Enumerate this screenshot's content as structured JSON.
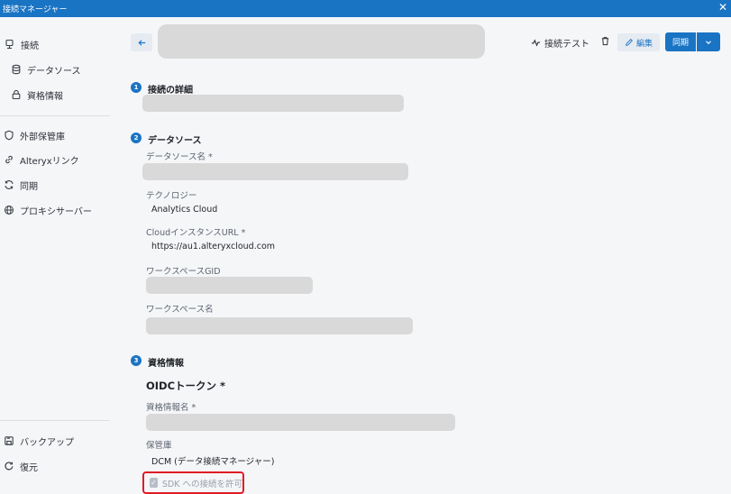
{
  "window": {
    "title": "接続マネージャー",
    "close_glyph": "✕"
  },
  "sidebar": {
    "items": [
      {
        "label": "接続",
        "icon": "connection-icon"
      },
      {
        "label": "データソース",
        "icon": "database-icon"
      },
      {
        "label": "資格情報",
        "icon": "lock-icon"
      },
      {
        "label": "外部保管庫",
        "icon": "shield-icon"
      },
      {
        "label": "Alteryxリンク",
        "icon": "link-icon"
      },
      {
        "label": "同期",
        "icon": "sync-icon"
      },
      {
        "label": "プロキシサーバー",
        "icon": "globe-icon"
      },
      {
        "label": "バックアップ",
        "icon": "save-icon"
      },
      {
        "label": "復元",
        "icon": "restore-icon"
      }
    ]
  },
  "toolbar": {
    "test_label": "接続テスト",
    "edit_label": "編集",
    "sync_label": "同期"
  },
  "sections": {
    "s1": {
      "num": "1",
      "title": "接続の詳細"
    },
    "s2": {
      "num": "2",
      "title": "データソース",
      "ds_name_label": "データソース名 *",
      "tech_label": "テクノロジー",
      "tech_value": "Analytics Cloud",
      "url_label": "CloudインスタンスURL *",
      "url_value": "https://au1.alteryxcloud.com",
      "gid_label": "ワークスペースGID",
      "ws_name_label": "ワークスペース名"
    },
    "s3": {
      "num": "3",
      "title": "資格情報",
      "oidc_title": "OIDCトークン *",
      "cred_name_label": "資格情報名 *",
      "vault_label": "保管庫",
      "vault_value": "DCM (データ接続マネージャー)",
      "sdk_label": "SDK への接続を許可"
    }
  },
  "colors": {
    "accent": "#1a74c4",
    "highlight": "#e01b24",
    "placeholder": "#d9d9d9"
  }
}
